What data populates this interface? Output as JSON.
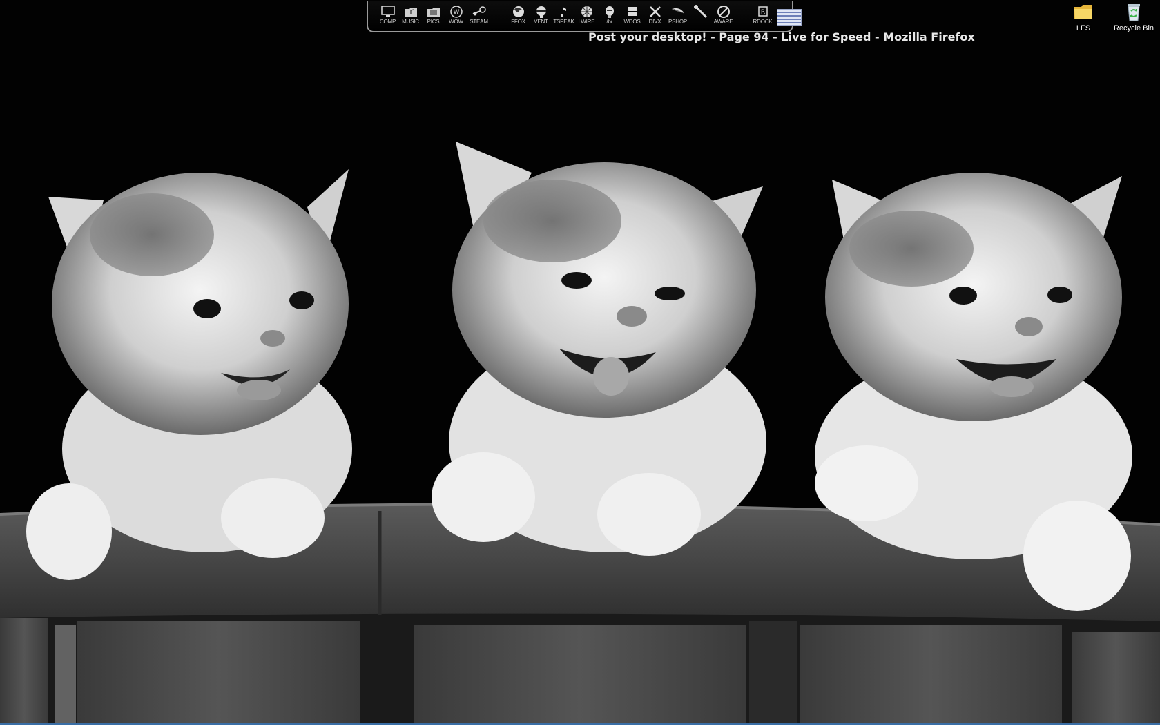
{
  "window_title": "Post your desktop! - Page 94 - Live for Speed - Mozilla Firefox",
  "dock": {
    "group1": [
      {
        "label": "COMP",
        "icon": "monitor-icon"
      },
      {
        "label": "MUSIC",
        "icon": "music-folder-icon"
      },
      {
        "label": "PICS",
        "icon": "pictures-folder-icon"
      },
      {
        "label": "WOW",
        "icon": "wow-logo-icon"
      },
      {
        "label": "STEAM",
        "icon": "steam-logo-icon"
      }
    ],
    "group2": [
      {
        "label": "FFOX",
        "icon": "firefox-icon"
      },
      {
        "label": "VENT",
        "icon": "ventrilo-icon"
      },
      {
        "label": "TSPEAK",
        "icon": "teamspeak-icon"
      },
      {
        "label": "LWIRE",
        "icon": "limewire-icon"
      },
      {
        "label": "/b/",
        "icon": "b-board-icon"
      },
      {
        "label": "WDOS",
        "icon": "windows-logo-icon"
      },
      {
        "label": "DIVX",
        "icon": "divx-icon"
      },
      {
        "label": "PSHOP",
        "icon": "photoshop-feather-icon"
      },
      {
        "label": "",
        "icon": "brush-icon"
      },
      {
        "label": "AWARE",
        "icon": "adaware-icon"
      }
    ],
    "group3": [
      {
        "label": "RDOCK",
        "icon": "rocketdock-icon"
      },
      {
        "label": "",
        "icon": "system-meter-icon"
      }
    ]
  },
  "desktop_icons": [
    {
      "label": "LFS",
      "icon": "folder-icon"
    },
    {
      "label": "Recycle Bin",
      "icon": "recycle-bin-icon"
    }
  ],
  "colors": {
    "background": "#000000",
    "folder": "#f3c94a",
    "recycle_arrows": "#3bb54a",
    "taskbar_hint": "#3a6ea5"
  }
}
